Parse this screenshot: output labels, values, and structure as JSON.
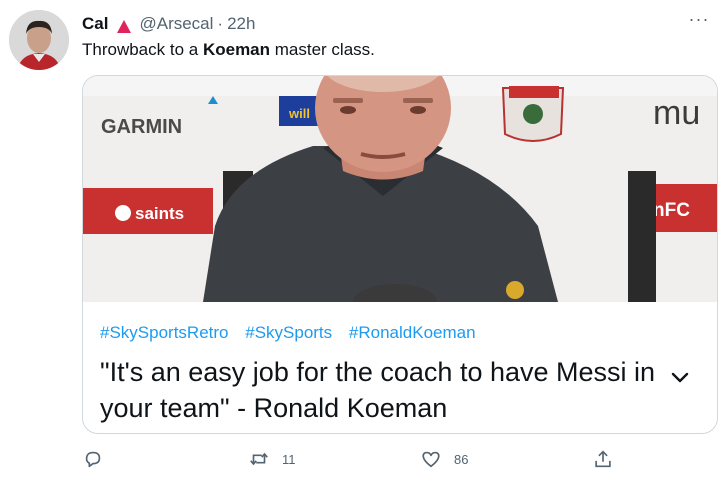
{
  "tweet": {
    "author_name": "Cal",
    "handle": "@Arsecal",
    "separator": "·",
    "time": "22h",
    "text_prefix": "Throwback to a ",
    "text_bold": "Koeman",
    "text_suffix": " master class.",
    "more_label": "···"
  },
  "card": {
    "hashtags": [
      "#SkySportsRetro",
      "#SkySports",
      "#RonaldKoeman"
    ],
    "quote": "\"It's an easy job for the coach to have Messi in your team\" - Ronald Koeman",
    "photo_signs": {
      "garmin": "GARMIN",
      "saints": "saints",
      "fc": "nFC",
      "mu": "mu",
      "will": "will"
    }
  },
  "actions": {
    "reply_count": "",
    "retweet_count": "11",
    "like_count": "86"
  },
  "colors": {
    "accent": "#1d9bf0",
    "badge": "#e0245e",
    "secondary_text": "#536471",
    "card_border": "#cfd9de"
  },
  "icons": {
    "badge": "red-triangle-icon",
    "reply": "reply-bubble-icon",
    "retweet": "retweet-icon",
    "like": "heart-icon",
    "share": "share-upload-icon",
    "more": "more-dots-icon",
    "expand": "chevron-down-icon"
  }
}
